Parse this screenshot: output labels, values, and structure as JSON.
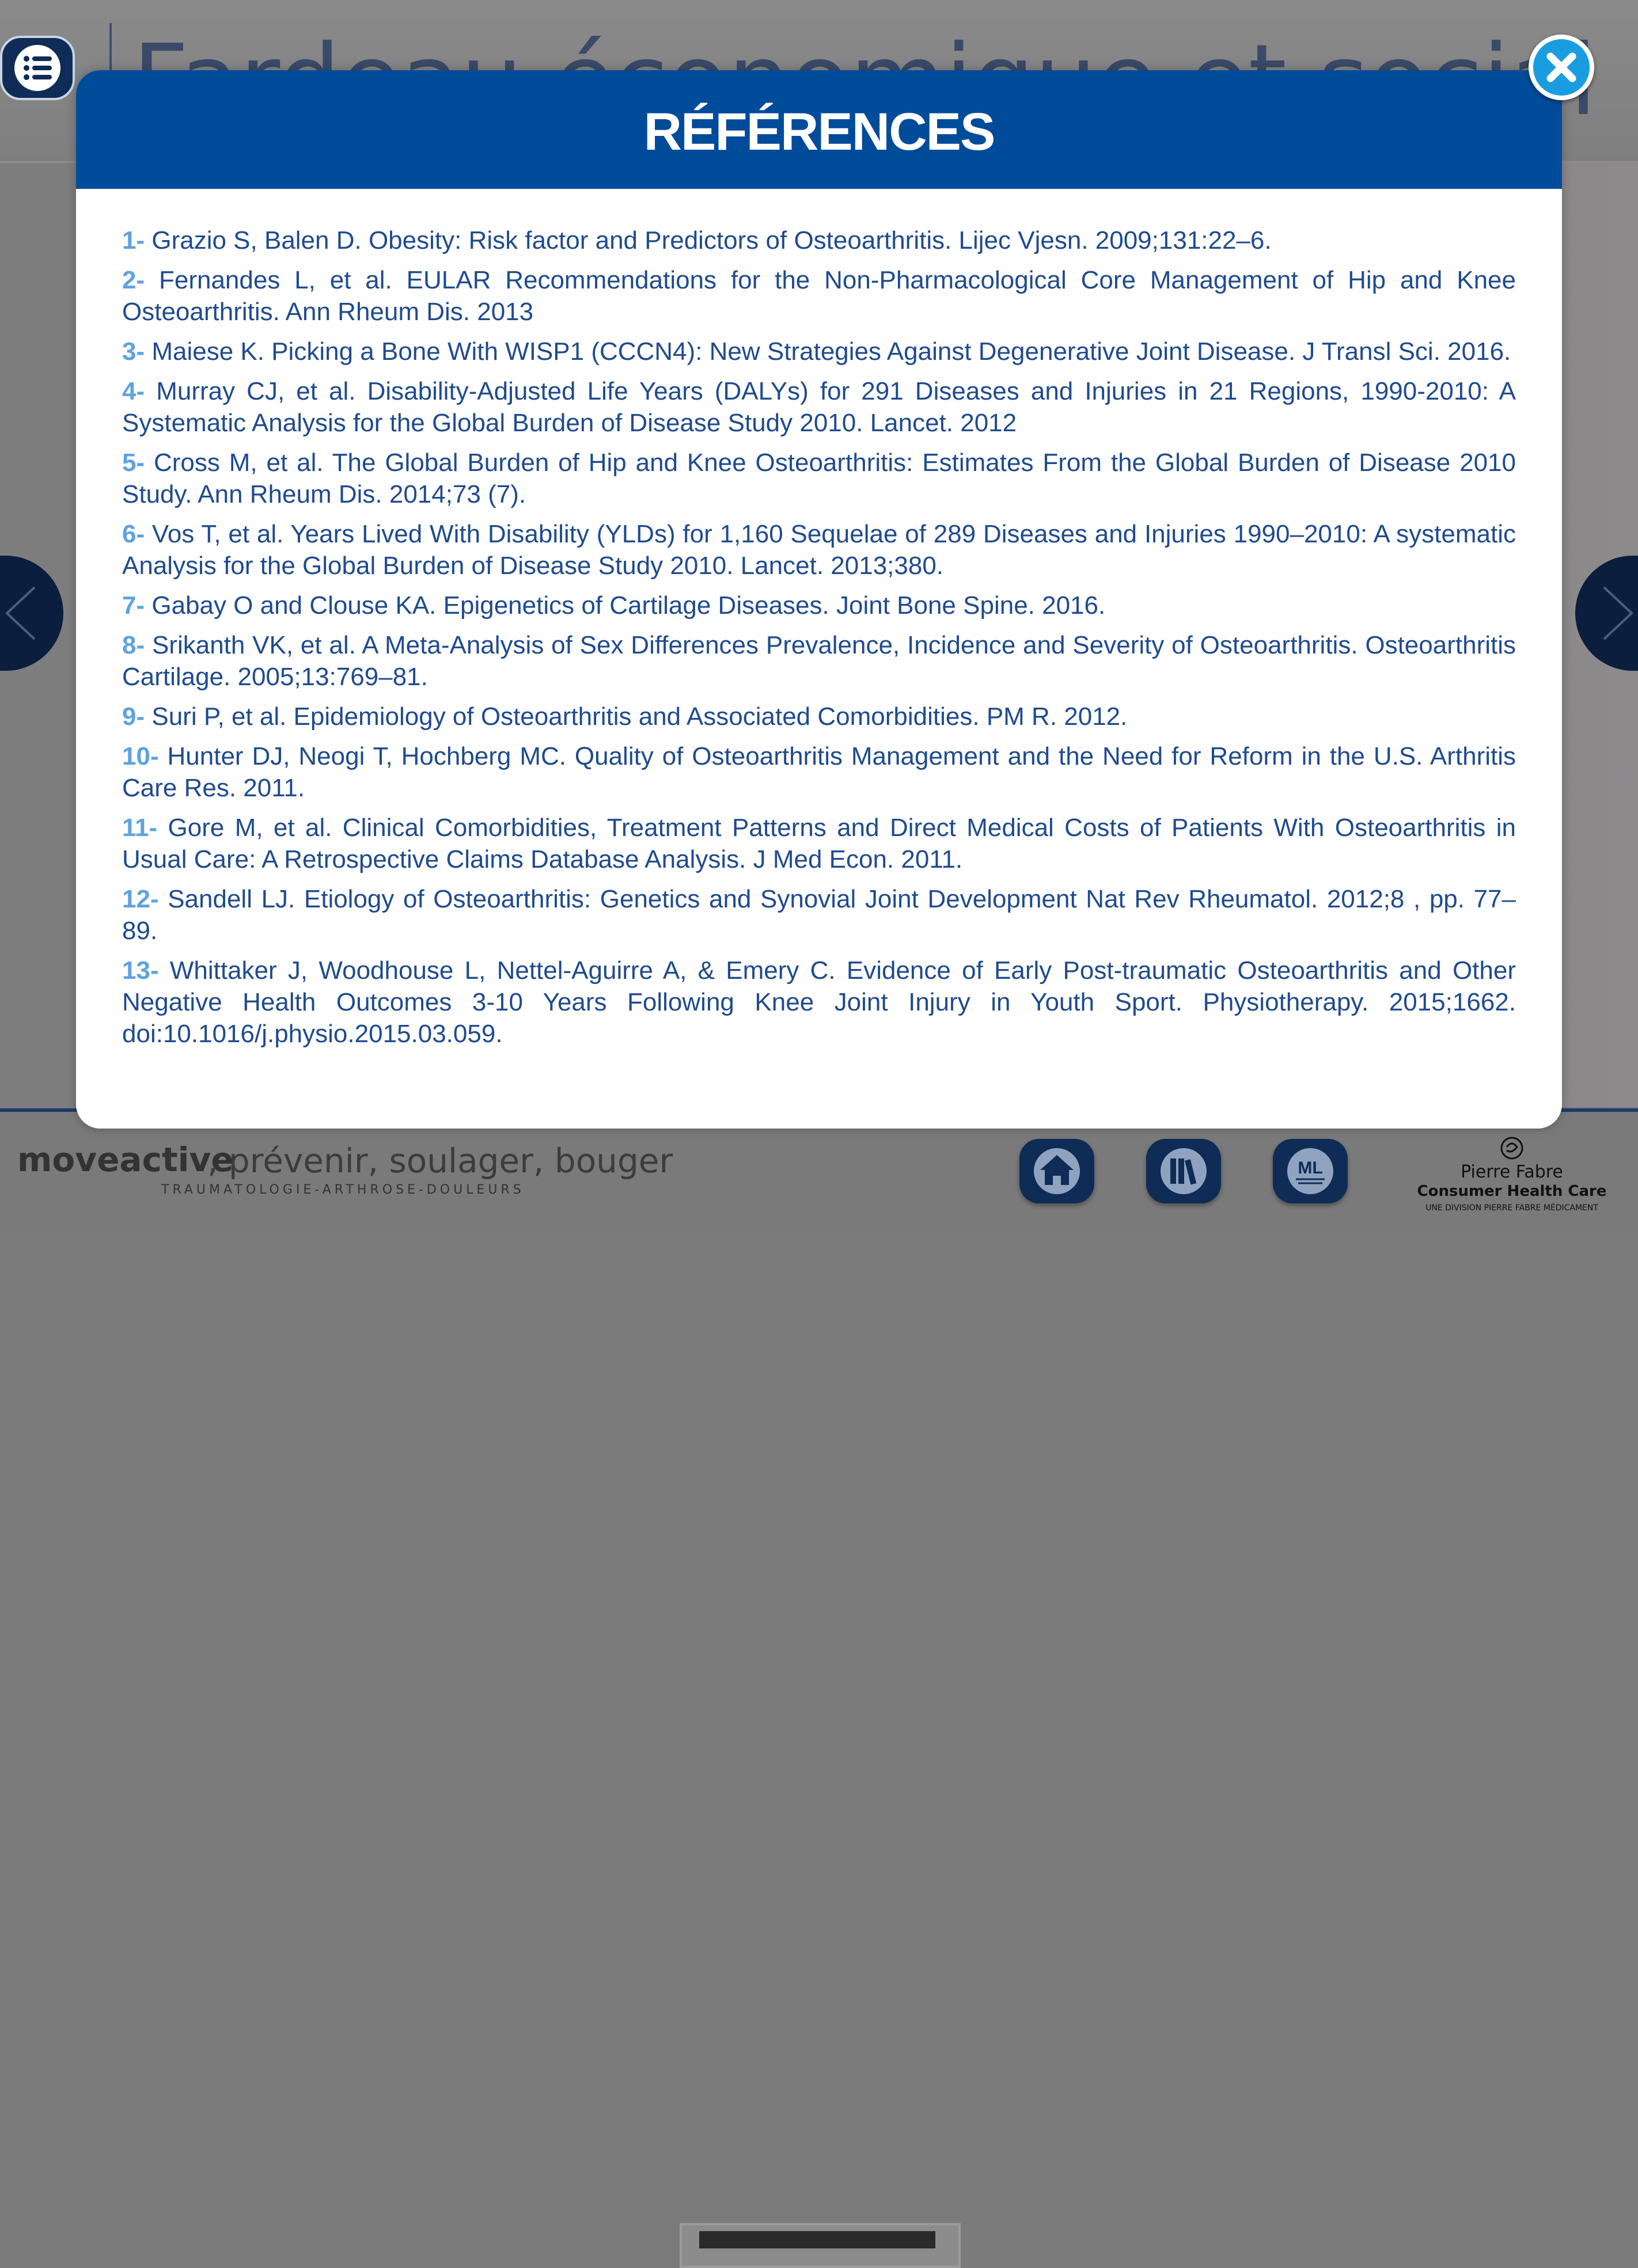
{
  "background": {
    "page_title": "Fardeau économique et social",
    "brand": {
      "name": "moveactive",
      "tagline": ", prévenir, soulager, bouger",
      "subtitle": "TRAUMATOLOGIE-ARTHROSE-DOULEURS"
    },
    "company": {
      "name": "Pierre Fabre",
      "line2": "Consumer Health Care",
      "line3": "UNE DIVISION PIERRE FABRE MÉDICAMENT"
    },
    "footer_buttons": [
      "home-icon",
      "library-icon",
      "ml-icon"
    ],
    "ml_label": "ML"
  },
  "modal": {
    "title": "RÉFÉRENCES",
    "references": [
      {
        "num": "1-",
        "text": " Grazio S, Balen D. Obesity: Risk factor and Predictors of Osteoarthritis. Lijec Vjesn. 2009;131:22–6."
      },
      {
        "num": "2-",
        "text": " Fernandes L, et al. EULAR Recommendations for the Non-Pharmacological Core Management of Hip and Knee Osteoarthritis. Ann Rheum Dis. 2013"
      },
      {
        "num": "3-",
        "text": " Maiese K. Picking a Bone With WISP1 (CCCN4): New Strategies Against Degenerative Joint Disease. J Transl Sci. 2016."
      },
      {
        "num": "4-",
        "text": " Murray CJ, et al. Disability-Adjusted Life Years (DALYs) for 291 Diseases and Injuries in 21 Regions, 1990-2010: A Systematic Analysis for the Global Burden of Disease Study 2010. Lancet. 2012"
      },
      {
        "num": "5-",
        "text": " Cross M, et al. The Global Burden of Hip and Knee Osteoarthritis: Estimates From the Global Burden of Disease 2010 Study. Ann Rheum Dis. 2014;73 (7)."
      },
      {
        "num": "6-",
        "text": " Vos T, et al. Years Lived With Disability (YLDs) for 1,160 Sequelae of 289 Diseases and Injuries 1990–2010: A systematic Analysis for the Global Burden of Disease Study 2010. Lancet. 2013;380."
      },
      {
        "num": "7-",
        "text": " Gabay O and Clouse KA. Epigenetics of Cartilage Diseases. Joint Bone Spine. 2016."
      },
      {
        "num": "8-",
        "text": " Srikanth VK, et al. A Meta-Analysis of Sex Differences Prevalence, Incidence and Severity of Osteoarthritis. Osteoarthritis Cartilage. 2005;13:769–81."
      },
      {
        "num": "9-",
        "text": " Suri P, et al. Epidemiology of Osteoarthritis and Associated Comorbidities. PM R. 2012."
      },
      {
        "num": "10-",
        "text": " Hunter DJ, Neogi T, Hochberg MC. Quality of Osteoarthritis Management and the Need for Reform in the U.S. Arthritis Care Res. 2011."
      },
      {
        "num": "11-",
        "text": " Gore M, et al. Clinical Comorbidities, Treatment Patterns and Direct Medical Costs of Patients With Osteoarthritis in Usual Care: A Retrospective Claims Database Analysis. J Med Econ. 2011."
      },
      {
        "num": "12-",
        "text": " Sandell LJ. Etiology of Osteoarthritis: Genetics and Synovial Joint Development Nat Rev Rheumatol. 2012;8 , pp. 77–89."
      },
      {
        "num": "13-",
        "text": " Whittaker J, Woodhouse L, Nettel-Aguirre A, & Emery C. Evidence of Early Post-traumatic Osteoarthritis and Other Negative Health Outcomes 3-10 Years Following Knee Joint Injury in Youth Sport. Physiotherapy. 2015;1662. doi:10.1016/j.physio.2015.03.059."
      }
    ]
  },
  "icons": {
    "menu": "list-icon",
    "close": "close-icon",
    "prev": "chevron-left-icon",
    "next": "chevron-right-icon"
  },
  "colors": {
    "header_blue": "#004b9a",
    "reference_text": "#1f4b8e",
    "reference_number": "#5fa3dd",
    "close_button": "#1a9de0"
  }
}
